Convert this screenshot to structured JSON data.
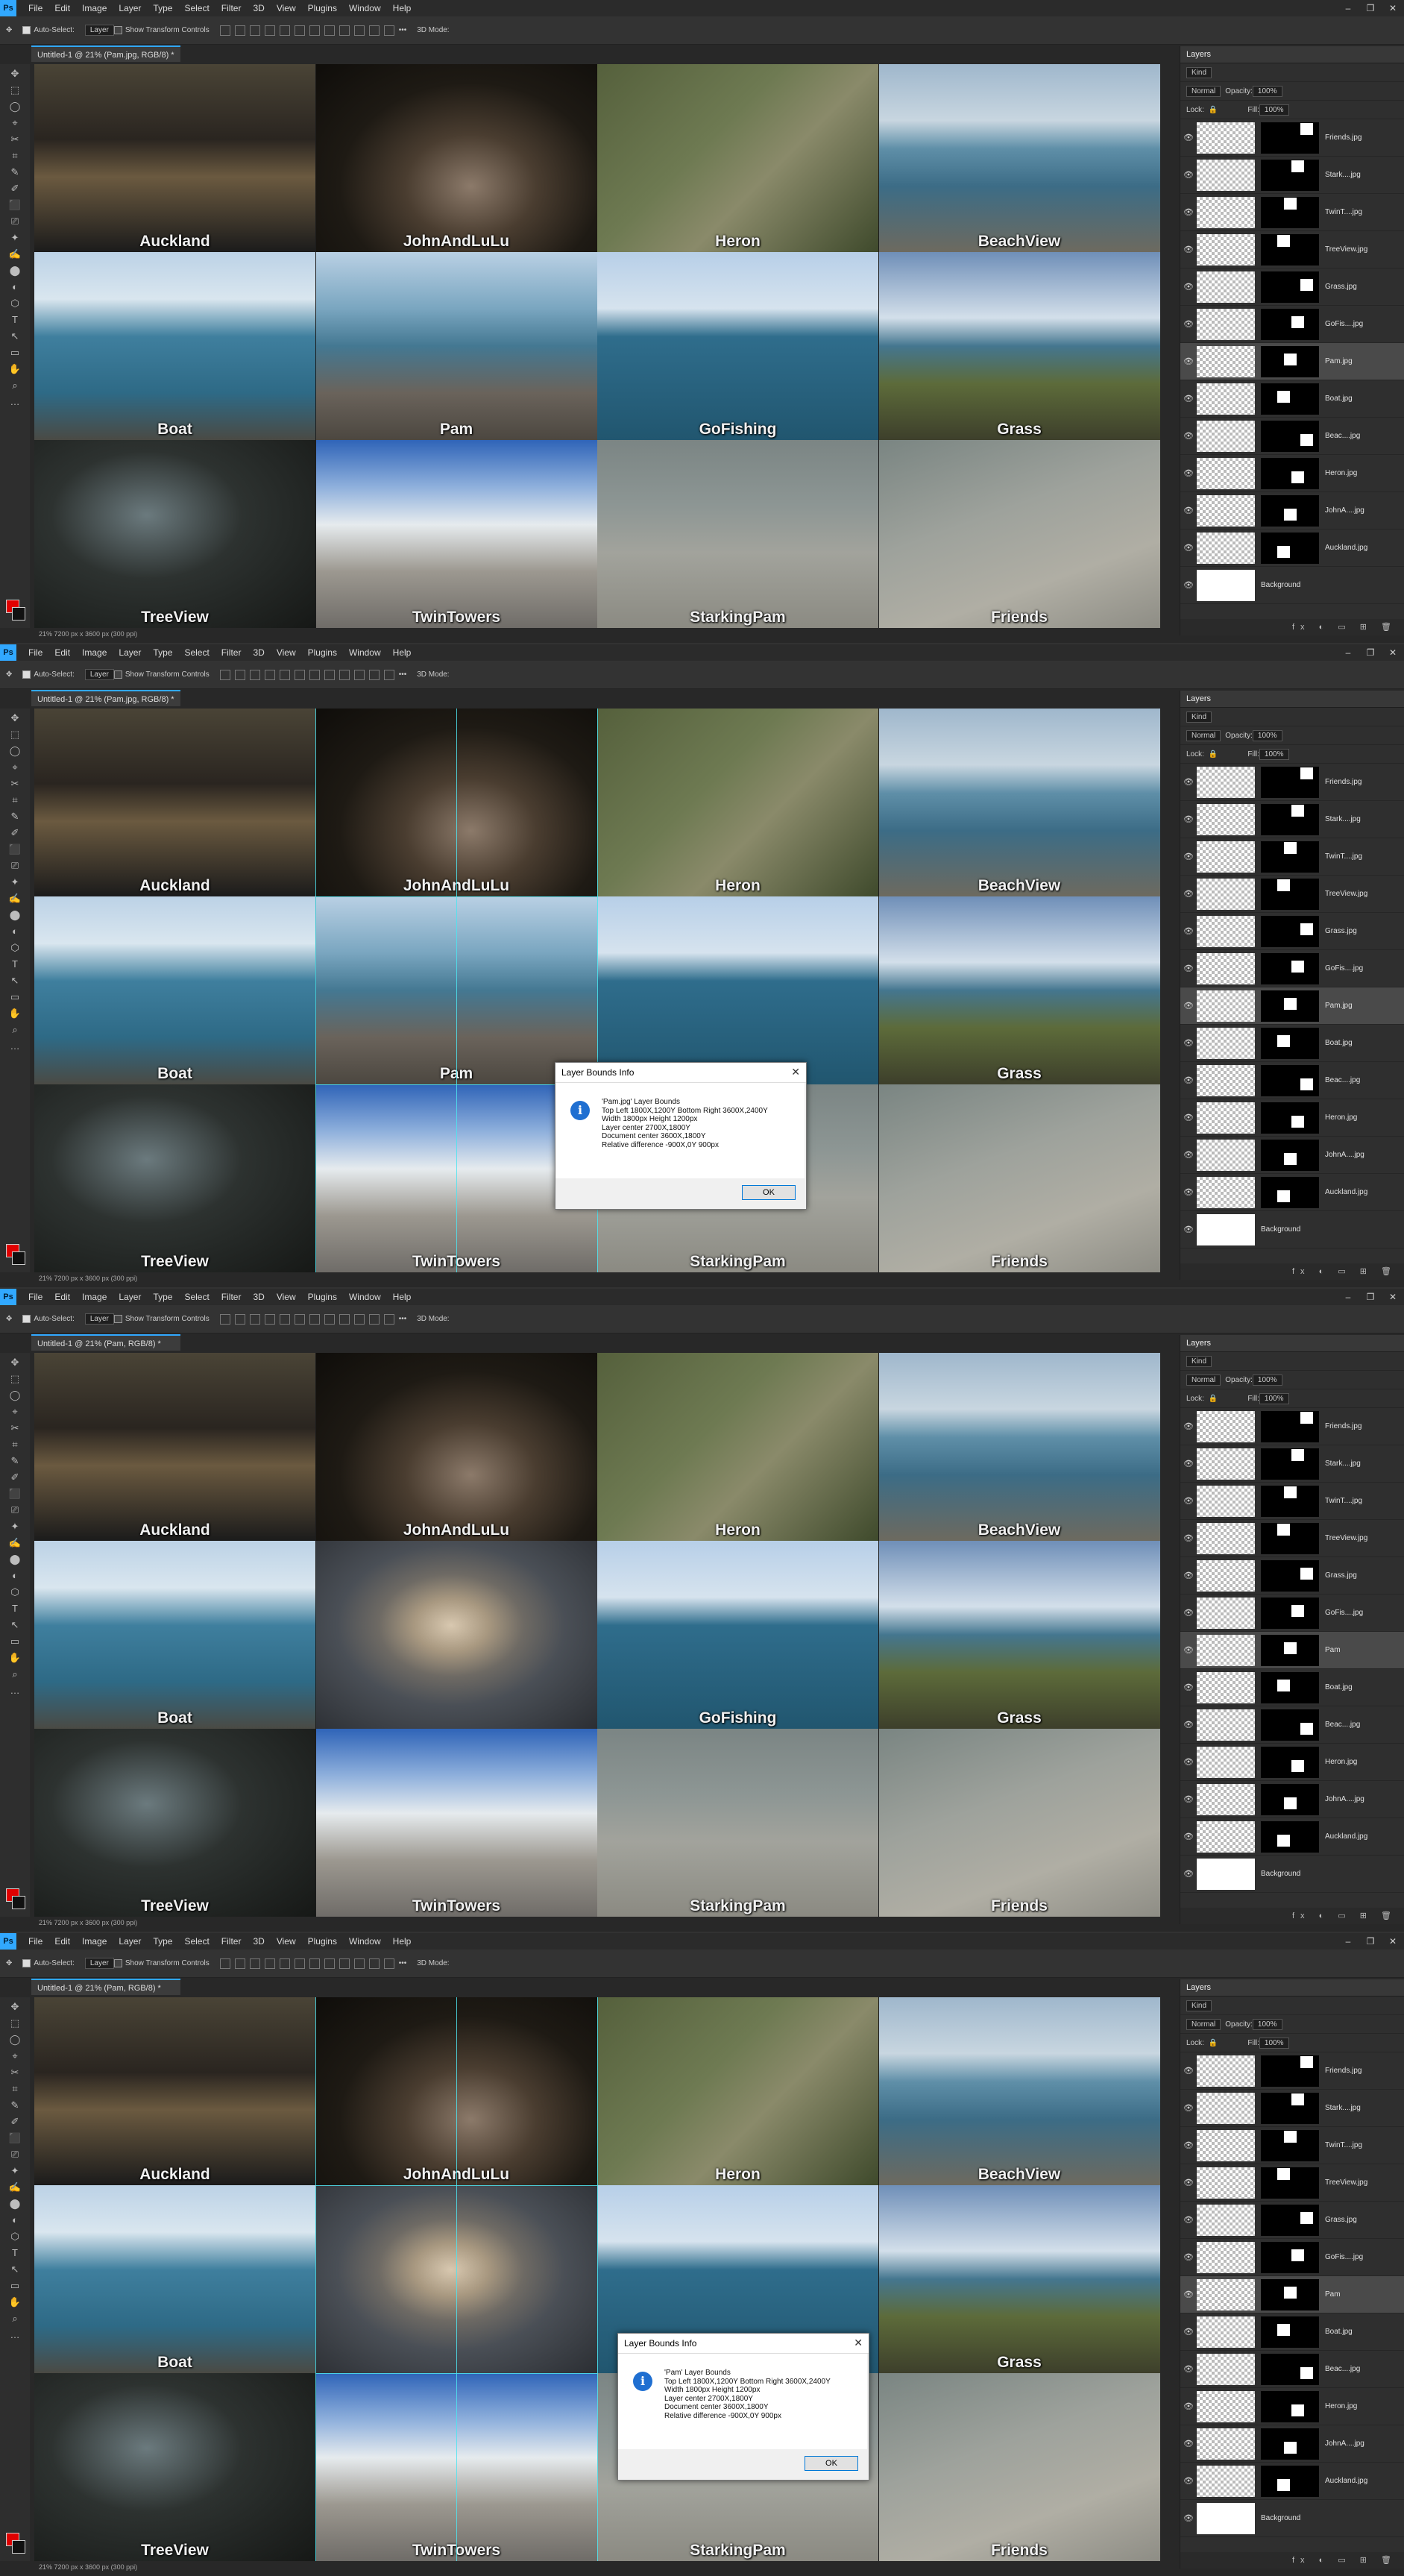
{
  "menu": [
    "File",
    "Edit",
    "Image",
    "Layer",
    "Type",
    "Select",
    "Filter",
    "3D",
    "View",
    "Plugins",
    "Window",
    "Help"
  ],
  "app_logo": "Ps",
  "window_controls": [
    "–",
    "❐",
    "✕"
  ],
  "options_bar": {
    "auto_select_label": "Auto-Select:",
    "auto_select_target": "Layer",
    "transform_label": "Show Transform Controls",
    "mode_label": "3D Mode:",
    "more": "•••"
  },
  "icons": {
    "eye": "👁",
    "lock": "🔒",
    "search": "⌕",
    "close": "✕",
    "info": "i",
    "tools": [
      "✥",
      "⬚",
      "◯",
      "⌖",
      "✂",
      "⌗",
      "✎",
      "✐",
      "⬛",
      "⎚",
      "✦",
      "✍",
      "⬤",
      "◐",
      "⬡",
      "T",
      "↖",
      "▭",
      "✋",
      "⌕",
      "…"
    ]
  },
  "screenshots": [
    {
      "doc_tab": "Untitled-1 @ 21% (Pam.jpg, RGB/8) *",
      "status": "21%     7200 px x 3600 px (300 ppi)",
      "pam_label": "Pam",
      "pam_style": "lighthouse",
      "active_layer": "Pam.jpg",
      "guides": false,
      "dialog": null
    },
    {
      "doc_tab": "Untitled-1 @ 21% (Pam.jpg, RGB/8) *",
      "status": "21%     7200 px x 3600 px (300 ppi)",
      "pam_label": "Pam",
      "pam_style": "lighthouse",
      "active_layer": "Pam.jpg",
      "guides": true,
      "dialog": {
        "title": "Layer Bounds Info",
        "lines": [
          "'Pam.jpg' Layer Bounds",
          "Top Left 1800X,1200Y   Bottom Right 3600X,2400Y",
          "Width 1800px   Height 1200px",
          "Layer center 2700X,1800Y",
          "Document center  3600X,1800Y",
          "Relative difference  -900X,0Y  900px"
        ],
        "ok": "OK"
      }
    },
    {
      "doc_tab": "Untitled-1 @ 21% (Pam, RGB/8) *",
      "status": "21%     7200 px x 3600 px (300 ppi)",
      "pam_label": "",
      "pam_style": "portrait",
      "active_layer": "Pam",
      "guides": false,
      "dialog": null
    },
    {
      "doc_tab": "Untitled-1 @ 21% (Pam, RGB/8) *",
      "status": "21%     7200 px x 3600 px (300 ppi)",
      "pam_label": "",
      "pam_style": "portrait",
      "active_layer": "Pam",
      "guides": true,
      "dialog": {
        "title": "Layer Bounds Info",
        "lines": [
          "'Pam' Layer Bounds",
          "Top Left 1800X,1200Y   Bottom Right 3600X,2400Y",
          "Width 1800px   Height 1200px",
          "Layer center 2700X,1800Y",
          "Document center  3600X,1800Y",
          "Relative difference  -900X,0Y  900px"
        ],
        "ok": "OK"
      }
    }
  ],
  "tiles": [
    {
      "label": "Auckland",
      "bg": "linear-gradient(180deg,#4a4436 0%,#2a2520 40%,#6b5a40 60%,#1b1b1b 100%)"
    },
    {
      "label": "JohnAndLuLu",
      "bg": "radial-gradient(ellipse at 55% 65%,#8c7a6a 0%,#4a3d30 30%,#1e1a14 60%,#0f0d0a 100%)"
    },
    {
      "label": "Heron",
      "bg": "linear-gradient(135deg,#55603c 0%,#6e7a52 40%,#8a8a6a 60%,#3f4a2c 100%)"
    },
    {
      "label": "BeachView",
      "bg": "linear-gradient(180deg,#9fb7cc 0%,#c8d6e0 30%,#5f8fa8 45%,#3c6c86 65%,#6d6a5f 100%)"
    },
    {
      "label": "Boat",
      "bg": "linear-gradient(180deg,#bcd2e6 0%,#d9e6ef 25%,#3f7f9e 45%,#2e6a86 75%,#4a4a44 100%)"
    },
    {
      "label": "Pam",
      "bg": "linear-gradient(180deg,#b9d0e4 0%,#7aa6c0 30%,#447892 50%,#6a635b 75%,#4c4740 100%)"
    },
    {
      "label": "GoFishing",
      "bg": "linear-gradient(180deg,#b7cfe8 0%,#d6e3ee 30%,#2f6d8c 45%,#21566f 100%)"
    },
    {
      "label": "Grass",
      "bg": "linear-gradient(180deg,#6f8fb8 0%,#d3dfea 35%,#44768f 50%,#5d6b3a 70%,#3d3f2b 100%)"
    },
    {
      "label": "TreeView",
      "bg": "radial-gradient(ellipse at 40% 40%,#6b7a7e 0%,#2d3230 40%,#161816 100%)"
    },
    {
      "label": "TwinTowers",
      "bg": "linear-gradient(180deg,#2f64b8 0%,#8fb0dc 25%,#e6ebee 45%,#9c9890 70%,#6f6c68 100%)"
    },
    {
      "label": "StarkingPam",
      "bg": "linear-gradient(180deg,#7b8584 0%,#8d9694 35%,#a2a39c 60%,#8b8a82 100%)"
    },
    {
      "label": "Friends",
      "bg": "linear-gradient(160deg,#7a8582 0%,#9ea29c 40%,#b0aea4 70%,#8e8d85 100%)"
    }
  ],
  "layers_panel": {
    "tab": "Layers",
    "kind": "Kind",
    "blend": "Normal",
    "opacity_label": "Opacity:",
    "opacity": "100%",
    "lock_label": "Lock:",
    "fill_label": "Fill:",
    "fill": "100%",
    "footer": "fx ◐ ▭ ⊞ 🗑",
    "layers_before": [
      "Friends.jpg",
      "Stark....jpg",
      "TwinT....jpg",
      "TreeView.jpg",
      "Grass.jpg",
      "GoFis....jpg",
      "Pam.jpg",
      "Boat.jpg",
      "Beac....jpg",
      "Heron.jpg",
      "JohnA....jpg",
      "Auckland.jpg",
      "Background"
    ],
    "layers_after": [
      "Friends.jpg",
      "Stark....jpg",
      "TwinT....jpg",
      "TreeView.jpg",
      "Grass.jpg",
      "GoFis....jpg",
      "Pam",
      "Boat.jpg",
      "Beac....jpg",
      "Heron.jpg",
      "JohnA....jpg",
      "Auckland.jpg",
      "Background"
    ]
  },
  "colors": {
    "guide": "#4ee4f0",
    "accent": "#31a8ff",
    "fg": "#e00000",
    "bg": "#111111"
  }
}
